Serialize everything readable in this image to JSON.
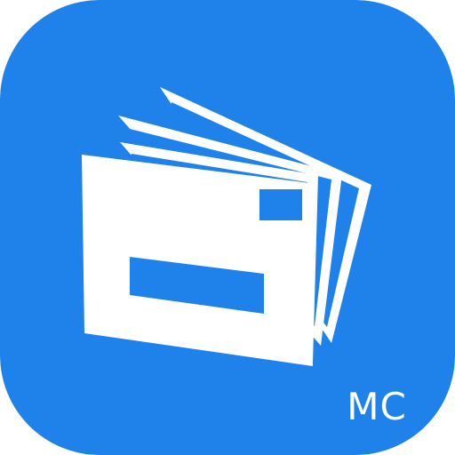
{
  "icon": {
    "name": "mail-envelope-stack-icon",
    "badge_text": "MC",
    "colors": {
      "background": "#1f82eb",
      "foreground": "#ffffff"
    }
  }
}
